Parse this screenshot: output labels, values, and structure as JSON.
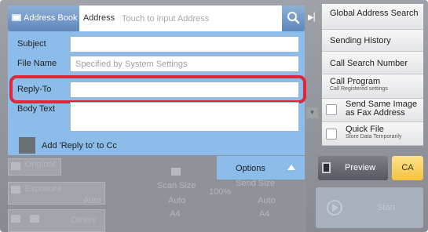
{
  "topbar": {
    "address_book": "Address Book",
    "address_tab": "Address",
    "address_placeholder": "Touch to input Address"
  },
  "right_panel": {
    "global_address_search": "Global Address Search",
    "sending_history": "Sending History",
    "call_search_number": "Call Search Number",
    "call_program": "Call Program",
    "call_program_sub": "Call Registered settings",
    "send_same_image": "Send Same Image",
    "send_same_image_2": "as Fax Address",
    "quick_file": "Quick File",
    "quick_file_sub": "Store Data Temporarily"
  },
  "form": {
    "subject_label": "Subject",
    "subject_value": "",
    "file_name_label": "File Name",
    "file_name_placeholder": "Specified by System Settings",
    "reply_to_label": "Reply-To",
    "reply_to_value": "",
    "body_text_label": "Body Text",
    "body_text_value": "",
    "add_cc_label": "Add 'Reply to' to Cc"
  },
  "options_label": "Options",
  "preview_label": "Preview",
  "ca_label": "CA",
  "background": {
    "original": "Original",
    "exposure": "Exposure",
    "exposure_value": "Auto",
    "others": "Others",
    "scan_size": "Scan Size",
    "scan_size_value": "Auto",
    "scan_size_paper": "A4",
    "ratio": "100%",
    "send_size": "Send Size",
    "send_size_value": "Auto",
    "send_size_paper": "A4",
    "start": "Start"
  },
  "colors": {
    "overlay": "#8bbcea",
    "tab_blue": "#6d93c6",
    "highlight": "#e1253a",
    "ca": "#f5c33e"
  }
}
